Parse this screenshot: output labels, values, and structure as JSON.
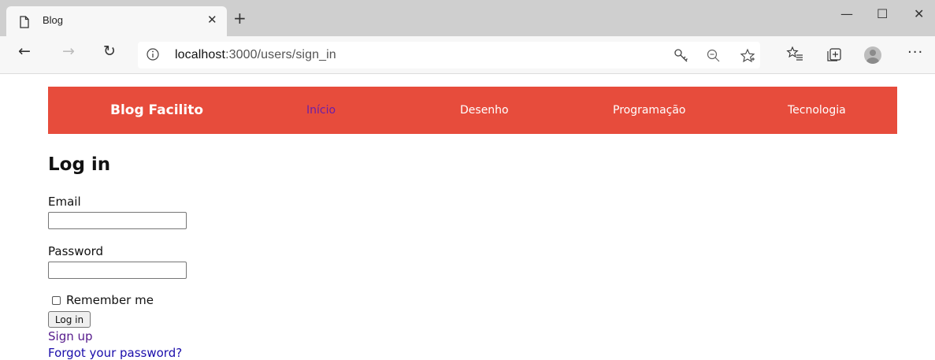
{
  "browser": {
    "tab": {
      "title": "Blog",
      "close_glyph": "✕"
    },
    "new_tab_glyph": "+",
    "window_controls": {
      "minimize": "—",
      "maximize": "☐",
      "close": "✕"
    },
    "nav": {
      "back": "←",
      "forward": "→",
      "reload": "↻"
    },
    "address": {
      "host": "localhost",
      "path": ":3000/users/sign_in"
    },
    "menu_glyph": "···"
  },
  "site": {
    "brand": "Blog Facilito",
    "nav_links": [
      "Início",
      "Desenho",
      "Programação",
      "Tecnologia"
    ],
    "nav_active_color": "#6b1fa8",
    "navbar_color": "#e74c3c"
  },
  "form": {
    "title": "Log in",
    "email_label": "Email",
    "email_value": "",
    "password_label": "Password",
    "password_value": "",
    "remember_label": "Remember me",
    "submit_label": "Log in",
    "sign_up_link": "Sign up",
    "forgot_link": "Forgot your password?"
  }
}
